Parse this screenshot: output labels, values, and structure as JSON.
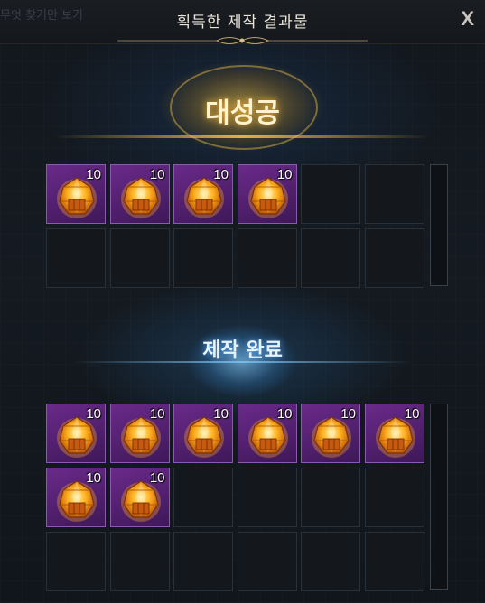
{
  "background_text": "무엇 찾기만 보기",
  "title": "획득한 제작 결과물",
  "close_label": "X",
  "great_success": {
    "label": "대성공",
    "items": [
      {
        "icon": "amber-gem-icon",
        "count": "10"
      },
      {
        "icon": "amber-gem-icon",
        "count": "10"
      },
      {
        "icon": "amber-gem-icon",
        "count": "10"
      },
      {
        "icon": "amber-gem-icon",
        "count": "10"
      }
    ]
  },
  "craft_complete": {
    "label": "제작 완료",
    "items": [
      {
        "icon": "amber-gem-icon",
        "count": "10"
      },
      {
        "icon": "amber-gem-icon",
        "count": "10"
      },
      {
        "icon": "amber-gem-icon",
        "count": "10"
      },
      {
        "icon": "amber-gem-icon",
        "count": "10"
      },
      {
        "icon": "amber-gem-icon",
        "count": "10"
      },
      {
        "icon": "amber-gem-icon",
        "count": "10"
      },
      {
        "icon": "amber-gem-icon",
        "count": "10"
      },
      {
        "icon": "amber-gem-icon",
        "count": "10"
      }
    ]
  },
  "colors": {
    "gold": "#f0be46",
    "slot_purple": "#6a2a8a",
    "blue_glow": "#78c8ff"
  }
}
